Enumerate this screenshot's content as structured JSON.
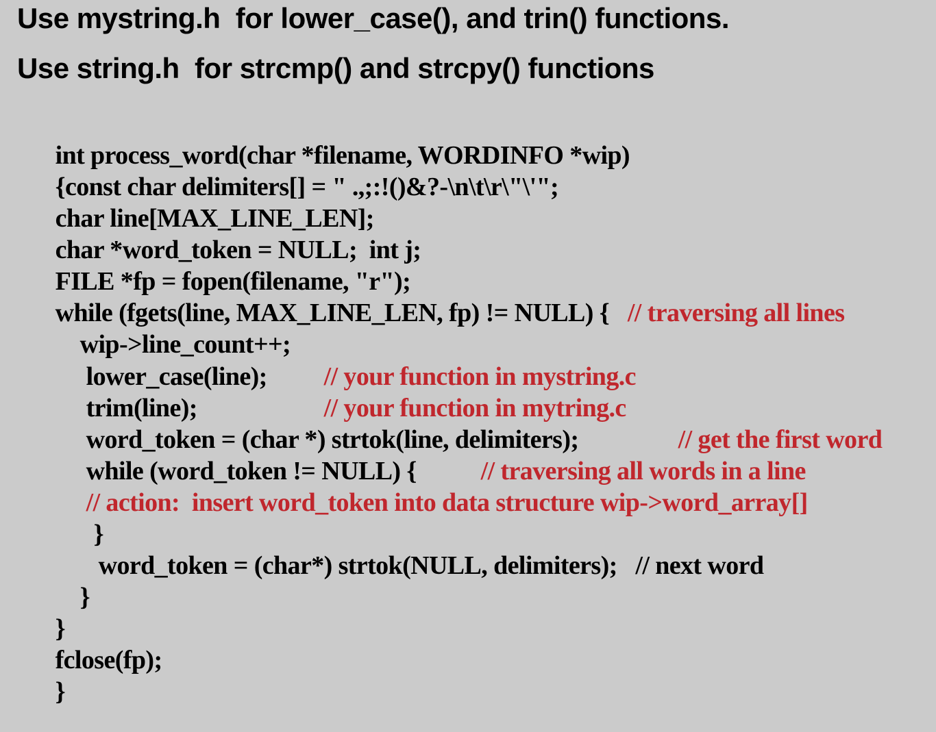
{
  "colors": {
    "background": "#cbcbcb",
    "text": "#000000",
    "comment": "#c0272d"
  },
  "headings": [
    "Use mystring.h  for lower_case(), and trin() functions.",
    "Use string.h  for strcmp() and strcpy() functions"
  ],
  "code_lines": [
    {
      "code": "int process_word(char *filename, WORDINFO *wip)",
      "gap": "",
      "comment": ""
    },
    {
      "code": "{const char delimiters[] = \" .,;:!()&?-\\n\\t\\r\\\"\\'\";",
      "gap": "",
      "comment": ""
    },
    {
      "code": "char line[MAX_LINE_LEN];",
      "gap": "",
      "comment": ""
    },
    {
      "code": "char *word_token = NULL;  int j;",
      "gap": "",
      "comment": ""
    },
    {
      "code": "FILE *fp = fopen(filename, \"r\");",
      "gap": "",
      "comment": ""
    },
    {
      "code": "while (fgets(line, MAX_LINE_LEN, fp) != NULL) {",
      "gap": "   ",
      "comment": "// traversing all lines"
    },
    {
      "code": "wip->line_count++;",
      "gap": "",
      "comment": ""
    },
    {
      "code": "lower_case(line);",
      "gap": "   ",
      "comment": "// your function in mystring.c"
    },
    {
      "code": "trim(line);",
      "gap": "",
      "comment": "// your function in mytring.c"
    },
    {
      "code": "word_token = (char *) strtok(line, delimiters);",
      "gap": "    ",
      "comment": "// get the first word"
    },
    {
      "code": "while (word_token != NULL) {",
      "gap": "     ",
      "comment": "// traversing all words in a line"
    },
    {
      "code": "",
      "gap": "",
      "comment": "// action:  insert word_token into data structure wip->word_array[]"
    },
    {
      "code": "}",
      "gap": "",
      "comment": ""
    },
    {
      "code": "word_token = (char*) strtok(NULL, delimiters);   // next word",
      "gap": "",
      "comment": ""
    },
    {
      "code": "}",
      "gap": "",
      "comment": ""
    },
    {
      "code": "}",
      "gap": "",
      "comment": ""
    },
    {
      "code": "fclose(fp);",
      "gap": "",
      "comment": ""
    },
    {
      "code": "}",
      "gap": "",
      "comment": ""
    }
  ]
}
